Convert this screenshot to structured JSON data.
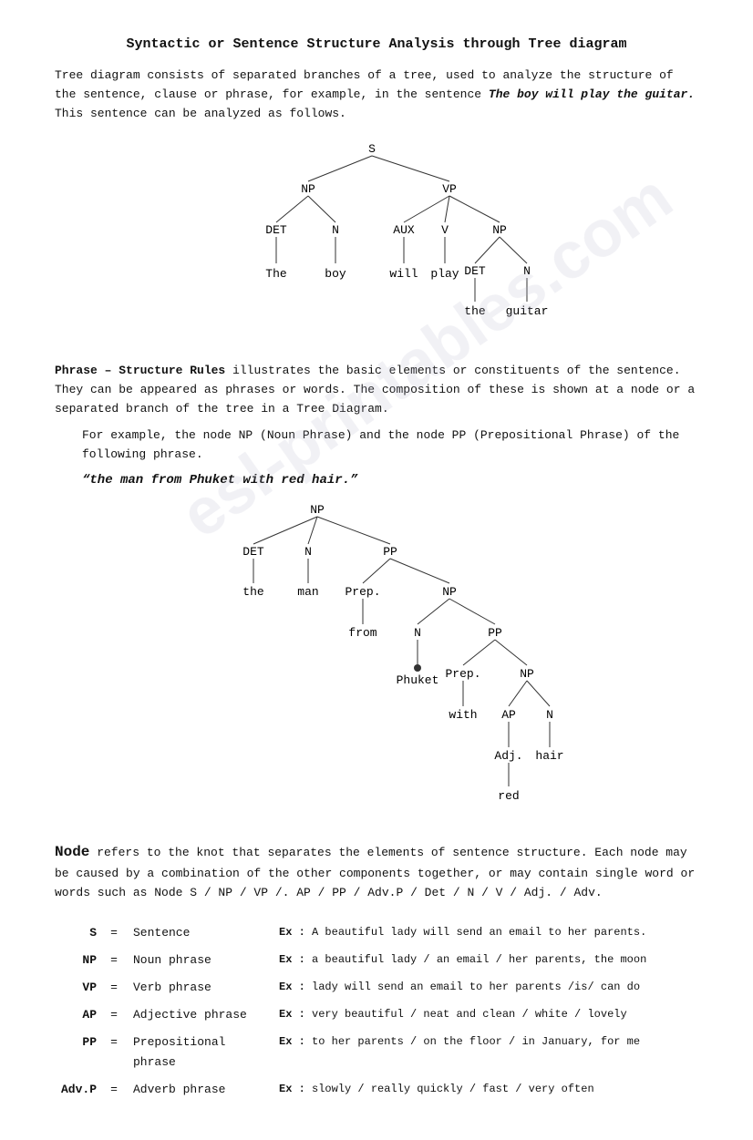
{
  "title": "Syntactic or Sentence Structure Analysis through Tree diagram",
  "intro": "Tree diagram consists of separated branches of a tree, used to analyze the structure of the sentence, clause or phrase, for example, in the sentence ",
  "intro_italic": "The boy will play the guitar.",
  "intro_end": " This sentence can be analyzed as follows.",
  "phrase_structure_header": "Phrase – Structure Rules",
  "phrase_structure_body": " illustrates the basic elements or constituents of the sentence. They can be appeared as phrases or words. The composition of these is shown at a node or a separated branch of the tree in a Tree Diagram.",
  "phrase_structure_body2": "For example, the node NP (Noun Phrase) and the node PP (Prepositional Phrase) of the following phrase.",
  "example_phrase": "“the man from Phuket with red hair.”",
  "node_header": "Node",
  "node_body": " refers to the knot that separates the elements of sentence structure. Each node may be caused by a combination of the other components together, or may contain single word or words such as Node S / NP / VP /. AP / PP / Adv.P / Det / N / V / Adj. / Adv.",
  "watermark": "esl-printables.com",
  "phrases": [
    {
      "abbr": "S",
      "eq": "=",
      "name": "Sentence",
      "ex_label": "Ex :",
      "ex_text": "A beautiful lady will send an email to her parents."
    },
    {
      "abbr": "NP",
      "eq": "=",
      "name": "Noun phrase",
      "ex_label": "Ex :",
      "ex_text": "a beautiful lady / an email / her parents, the moon"
    },
    {
      "abbr": "VP",
      "eq": "=",
      "name": "Verb phrase",
      "ex_label": "Ex :",
      "ex_text": "lady will send an email to her parents /is/ can do"
    },
    {
      "abbr": "AP",
      "eq": "=",
      "name": "Adjective phrase",
      "ex_label": "Ex :",
      "ex_text": "very beautiful / neat and clean / white / lovely"
    },
    {
      "abbr": "PP",
      "eq": "=",
      "name": "Prepositional phrase",
      "ex_label": "Ex :",
      "ex_text": "to her parents / on the floor / in January, for me"
    },
    {
      "abbr": "Adv.P",
      "eq": "=",
      "name": "Adverb phrase",
      "ex_label": "Ex :",
      "ex_text": "slowly / really quickly / fast / very often"
    }
  ]
}
